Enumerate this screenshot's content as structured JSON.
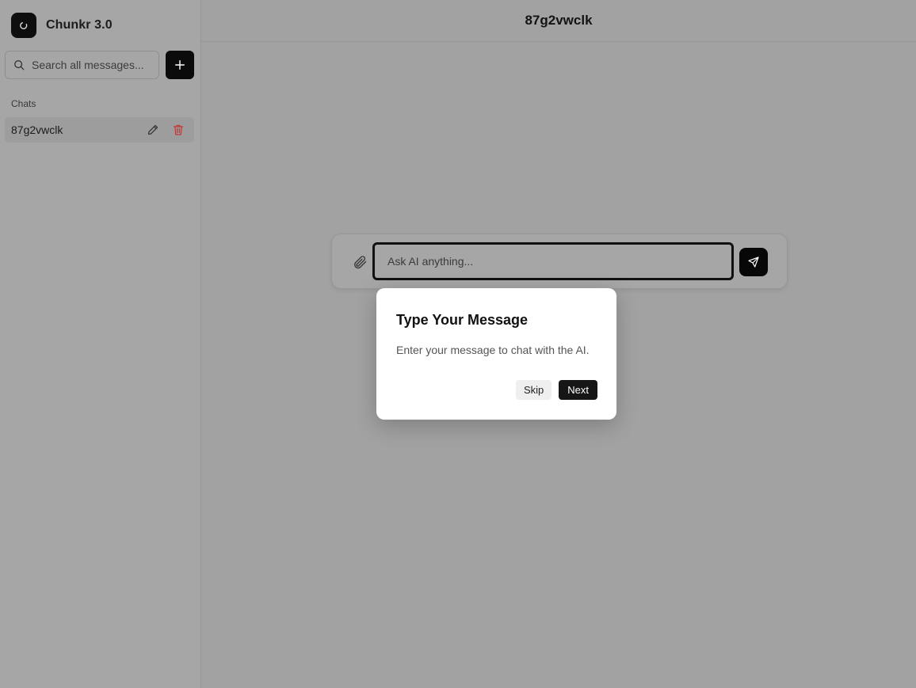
{
  "app": {
    "title": "Chunkr 3.0"
  },
  "sidebar": {
    "search_placeholder": "Search all messages...",
    "new_chat_icon": "plus-icon",
    "section_label": "Chats",
    "chats": [
      {
        "label": "87g2vwclk",
        "edit_icon": "pencil-icon",
        "delete_icon": "trash-icon"
      }
    ]
  },
  "main": {
    "chat_title": "87g2vwclk",
    "composer": {
      "placeholder": "Ask AI anything...",
      "attach_icon": "paperclip-icon",
      "send_icon": "send-icon"
    }
  },
  "tour": {
    "title": "Type Your Message",
    "body": "Enter your message to chat with the AI.",
    "skip_label": "Skip",
    "next_label": "Next"
  },
  "colors": {
    "overlay_dim": "#9f9f9f",
    "dark_button": "#0b0b0b",
    "delete_red": "#c43a3a",
    "popover_bg": "#ffffff"
  }
}
